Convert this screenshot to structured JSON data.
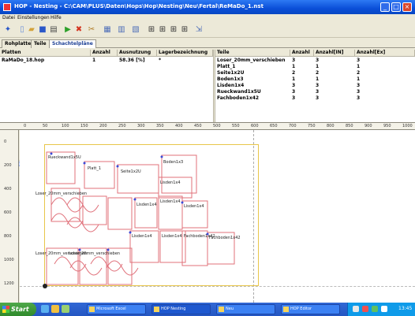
{
  "window": {
    "title": "HOP - Nesting - C:\\CAM\\PLUS\\Daten\\Hops\\Hop\\Nesting\\Neu\\Fertal\\ReMaDo_1.nst",
    "controls": {
      "minimize": "_",
      "maximize": "□",
      "close": "×"
    }
  },
  "menu": [
    "Datei",
    "Einstellungen",
    "Hilfe"
  ],
  "toolbar_icons": [
    "settings-icon",
    "new-icon",
    "open-icon",
    "save-icon",
    "print-icon",
    "play-icon",
    "stop-icon",
    "cut-icon",
    "board-icon",
    "grid-icon",
    "chart-icon",
    "layout-a-icon",
    "layout-b-icon",
    "layout-c-icon",
    "layout-d-icon",
    "export-icon"
  ],
  "tabs": {
    "items": [
      "Rohplatten",
      "Teile",
      "Schachtelpläne"
    ],
    "active": 2
  },
  "plates_table": {
    "headers": [
      "Platten",
      "Anzahl",
      "Ausnutzung",
      "Lagerbezeichnung"
    ],
    "rows": [
      [
        "RaMaDo_18.hop",
        "1",
        "58.36 [%]",
        "*"
      ]
    ]
  },
  "parts_table": {
    "headers": [
      "Teile",
      "Anzahl",
      "Anzahl[IN]",
      "Anzahl[Ex]"
    ],
    "rows": [
      [
        "Loser_20mm_verschieben",
        "3",
        "3",
        "3"
      ],
      [
        "Platt_1",
        "1",
        "1",
        "1"
      ],
      [
        "Seite1x2U",
        "2",
        "2",
        "2"
      ],
      [
        "Boden1x3",
        "1",
        "1",
        "1"
      ],
      [
        "Lisden1x4",
        "3",
        "3",
        "3"
      ],
      [
        "Rueckwand1x5U",
        "3",
        "3",
        "3"
      ],
      [
        "Fachboden1x42",
        "3",
        "3",
        "3"
      ]
    ]
  },
  "ruler_h_labels": [
    "0",
    "50",
    "100",
    "150",
    "200",
    "250",
    "300",
    "350",
    "400",
    "450",
    "500",
    "550",
    "600",
    "650",
    "700",
    "750",
    "800",
    "850",
    "900",
    "950",
    "1000"
  ],
  "ruler_v_labels": [
    "0",
    "200",
    "400",
    "600",
    "800",
    "1000",
    "1200"
  ],
  "nesting": {
    "part_labels": [
      "Rueckwand1x5U",
      "Platt_1",
      "Seite1x2U",
      "Boden1x3",
      "Lisden1x4",
      "Lisden1x4",
      "Lisden1x4",
      "Lisden1x4",
      "Lisden1x4",
      "Lisden1x4",
      "Fachboden1x42",
      "Fachboden1x42",
      "Loser_20mm_verschieben",
      "Loser_20mm_verschieben",
      "Loser_20mm_verschieben"
    ],
    "colors": {
      "part_outline": "#e0707a",
      "sheet_border": "#e8c64a",
      "marker": "#3a4ad8"
    }
  },
  "taskbar": {
    "start_label": "Start",
    "tasks": [
      "Microsoft Excel",
      "HOP Nesting",
      "Neu",
      "HOP Editor"
    ],
    "clock": "13:45"
  }
}
